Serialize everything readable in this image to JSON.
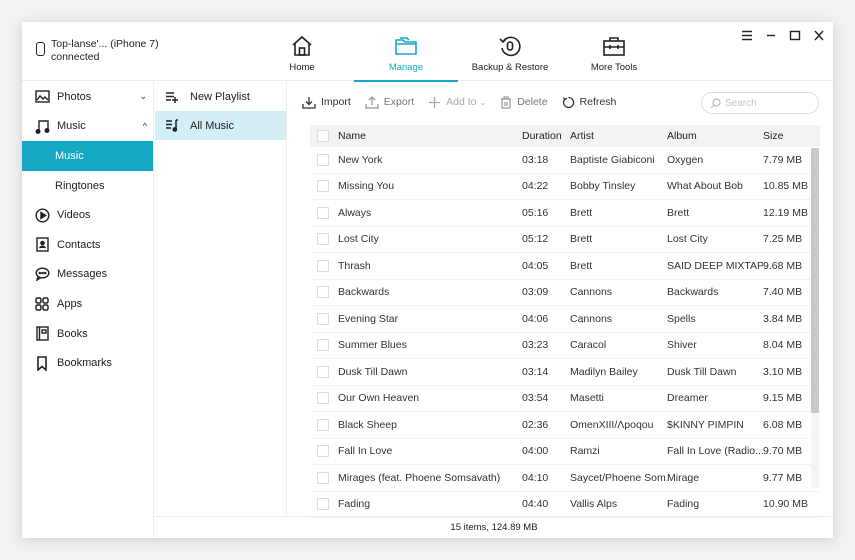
{
  "device": {
    "name": "Top-lanse'... (iPhone 7)",
    "status": "connected"
  },
  "nav": {
    "tabs": [
      {
        "label": "Home",
        "icon": "home-icon",
        "active": false
      },
      {
        "label": "Manage",
        "icon": "folder-icon",
        "active": true
      },
      {
        "label": "Backup & Restore",
        "icon": "backup-restore-icon",
        "active": false
      },
      {
        "label": "More Tools",
        "icon": "toolbox-icon",
        "active": false
      }
    ]
  },
  "window_controls": {
    "menu": "☰",
    "minimize": "–",
    "maximize": "☐",
    "close": "✕"
  },
  "sidebar": {
    "items": [
      {
        "label": "Photos",
        "icon": "photos-icon",
        "chevron": "⌄"
      },
      {
        "label": "Music",
        "icon": "music-icon",
        "chevron": "^"
      },
      {
        "label": "Music",
        "sub": true,
        "active": true
      },
      {
        "label": "Ringtones",
        "sub": true
      },
      {
        "label": "Videos",
        "icon": "videos-icon"
      },
      {
        "label": "Contacts",
        "icon": "contacts-icon"
      },
      {
        "label": "Messages",
        "icon": "messages-icon"
      },
      {
        "label": "Apps",
        "icon": "apps-icon"
      },
      {
        "label": "Books",
        "icon": "books-icon"
      },
      {
        "label": "Bookmarks",
        "icon": "bookmarks-icon"
      }
    ]
  },
  "playlists": {
    "new_playlist": "New Playlist",
    "all_music": "All Music"
  },
  "toolbar": {
    "import": "Import",
    "export": "Export",
    "add_to": "Add to",
    "delete": "Delete",
    "refresh": "Refresh",
    "search_placeholder": "Search"
  },
  "table": {
    "headers": {
      "name": "Name",
      "duration": "Duration",
      "artist": "Artist",
      "album": "Album",
      "size": "Size"
    },
    "rows": [
      {
        "name": "New York",
        "duration": "03:18",
        "artist": "Baptiste Giabiconi",
        "album": "Oxygen",
        "size": "7.79 MB"
      },
      {
        "name": "Missing You",
        "duration": "04:22",
        "artist": "Bobby Tinsley",
        "album": "What About Bob",
        "size": "10.85 MB"
      },
      {
        "name": "Always",
        "duration": "05:16",
        "artist": "Brett",
        "album": "Brett",
        "size": "12.19 MB"
      },
      {
        "name": "Lost City",
        "duration": "05:12",
        "artist": "Brett",
        "album": "Lost City",
        "size": "7.25 MB"
      },
      {
        "name": "Thrash",
        "duration": "04:05",
        "artist": "Brett",
        "album": "SAID DEEP MIXTAP...",
        "size": "9.68 MB"
      },
      {
        "name": "Backwards",
        "duration": "03:09",
        "artist": "Cannons",
        "album": "Backwards",
        "size": "7.40 MB"
      },
      {
        "name": "Evening Star",
        "duration": "04:06",
        "artist": "Cannons",
        "album": "Spells",
        "size": "3.84 MB"
      },
      {
        "name": "Summer Blues",
        "duration": "03:23",
        "artist": "Caracol",
        "album": "Shiver",
        "size": "8.04 MB"
      },
      {
        "name": "Dusk Till Dawn",
        "duration": "03:14",
        "artist": "Madilyn Bailey",
        "album": "Dusk Till Dawn",
        "size": "3.10 MB"
      },
      {
        "name": "Our Own Heaven",
        "duration": "03:54",
        "artist": "Masetti",
        "album": "Dreamer",
        "size": "9.15 MB"
      },
      {
        "name": "Black Sheep",
        "duration": "02:36",
        "artist": "OmenXIII/Ʌpoqou",
        "album": "$KINNY PIMPIN",
        "size": "6.08 MB"
      },
      {
        "name": "Fall In Love",
        "duration": "04:00",
        "artist": "Ramzi",
        "album": "Fall In Love (Radio...",
        "size": "9.70 MB"
      },
      {
        "name": "Mirages (feat. Phoene Somsavath)",
        "duration": "04:10",
        "artist": "Saycet/Phoene Som...",
        "album": "Mirage",
        "size": "9.77 MB"
      },
      {
        "name": "Fading",
        "duration": "04:40",
        "artist": "Vallis Alps",
        "album": "Fading",
        "size": "10.90 MB"
      }
    ]
  },
  "status": "15 items, 124.89 MB",
  "colors": {
    "accent": "#19a9c9",
    "selected_sub": "#15a9c6",
    "selected_playlist": "#d3eef4"
  }
}
